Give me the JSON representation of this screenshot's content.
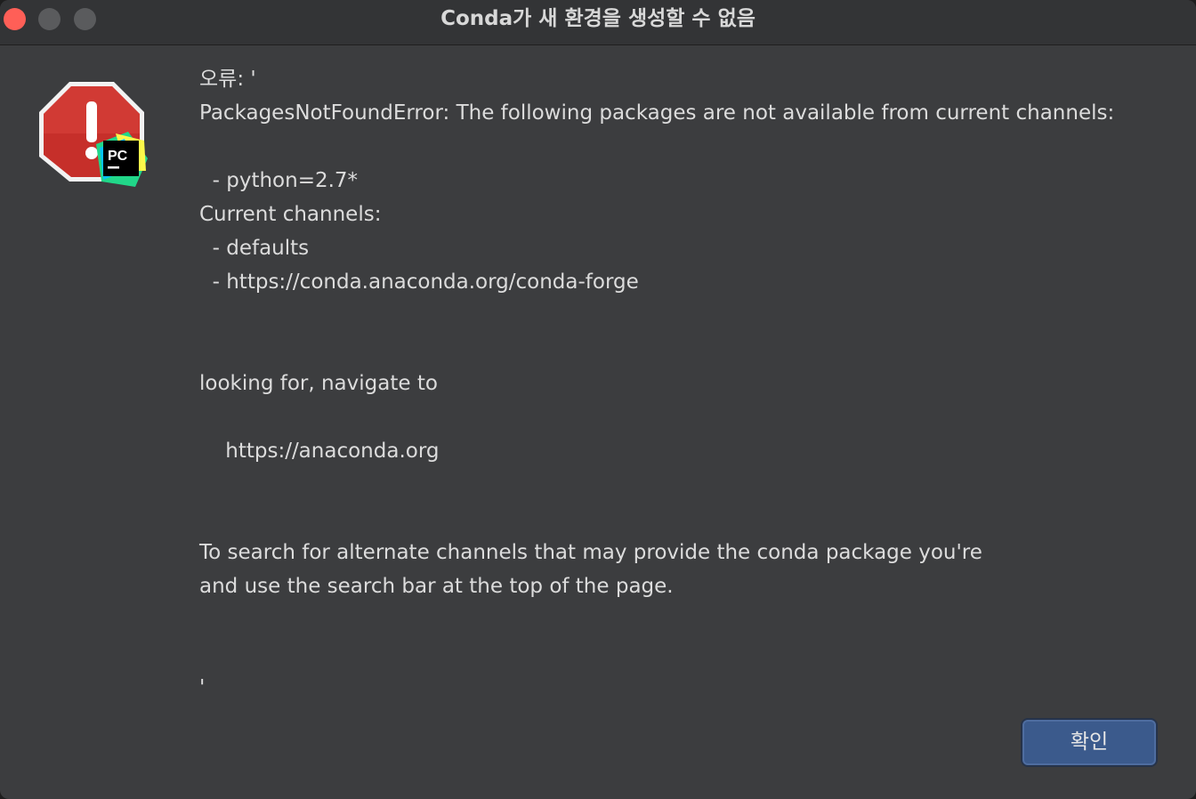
{
  "window": {
    "title": "Conda가 새 환경을 생성할 수 없음"
  },
  "icon": {
    "main": "stop-alert-icon",
    "badge_text": "PC"
  },
  "message": {
    "lines": [
      "오류: '",
      "PackagesNotFoundError: The following packages are not available from current channels:",
      "",
      "  - python=2.7*",
      "Current channels:",
      "  - defaults",
      "  - https://conda.anaconda.org/conda-forge",
      "",
      "",
      "looking for, navigate to",
      "",
      "    https://anaconda.org",
      "",
      "",
      "To search for alternate channels that may provide the conda package you're",
      "and use the search bar at the top of the page.",
      "",
      "",
      "'"
    ]
  },
  "buttons": {
    "ok_label": "확인"
  },
  "colors": {
    "background": "#3c3d3f",
    "titlebar": "#333436",
    "close": "#ff5f57",
    "button": "#3b5a8c",
    "stop_red": "#c9302c"
  }
}
